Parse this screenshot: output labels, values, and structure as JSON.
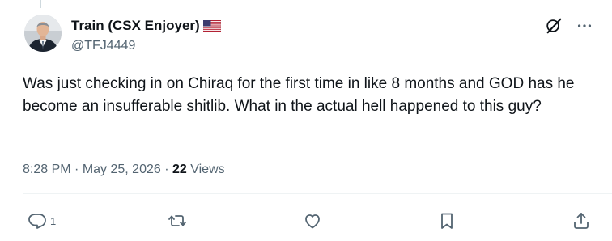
{
  "author": {
    "display_name": "Train (CSX Enjoyer)",
    "handle": "@TFJ4449",
    "flag_icon": "us-flag-icon"
  },
  "tweet": {
    "text": "Was just checking in on Chiraq for the first time in like 8 months and GOD has he become an insufferable shitlib. What in the actual hell happened to this guy?",
    "time": "8:28 PM",
    "separator1": " · ",
    "date": "May 25, 2026",
    "separator2": " · ",
    "views_count": "22",
    "views_label": " Views"
  },
  "actions": {
    "reply_count": "1",
    "retweet_count": "",
    "like_count": "",
    "bookmark_count": ""
  },
  "icons": {
    "top": [
      "grok-icon",
      "more-icon"
    ],
    "bottom": [
      "reply-icon",
      "retweet-icon",
      "like-icon",
      "bookmark-icon",
      "share-icon"
    ]
  },
  "colors": {
    "text": "#0f1419",
    "secondary": "#536471",
    "divider": "#eff3f4"
  }
}
